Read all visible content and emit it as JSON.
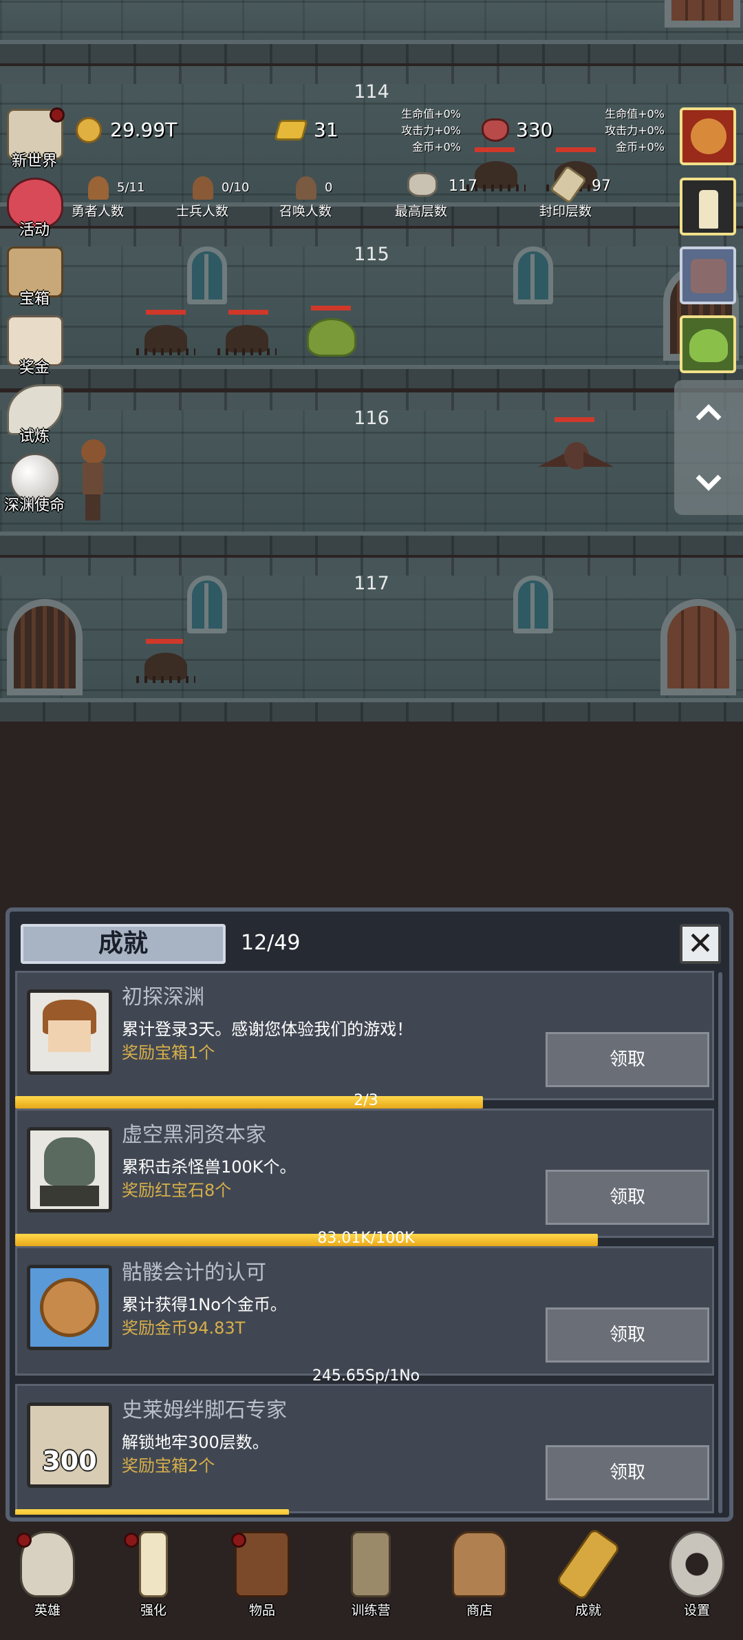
{
  "floors": [
    {
      "number": "114"
    },
    {
      "number": "115"
    },
    {
      "number": "116"
    },
    {
      "number": "117"
    }
  ],
  "stats": {
    "gold": "29.99T",
    "gold_bar": "31",
    "ruby": "330",
    "bonus_left": [
      "生命值+0%",
      "攻击力+0%",
      "金币+0%"
    ],
    "bonus_right": [
      "生命值+0%",
      "攻击力+0%",
      "金币+0%"
    ],
    "brave_count": "5/11",
    "brave_label": "勇者人数",
    "soldier_count": "0/10",
    "soldier_label": "士兵人数",
    "summon_count": "0",
    "summon_label": "召唤人数",
    "max_floor_value": "117",
    "max_floor_label": "最高层数",
    "sealed_floor_value": "97",
    "sealed_floor_label": "封印层数"
  },
  "side_menu": [
    {
      "label": "新世界",
      "icon": "map-icon",
      "dot": true
    },
    {
      "label": "活动",
      "icon": "heart-icon",
      "dot": false
    },
    {
      "label": "宝箱",
      "icon": "chest-icon",
      "dot": false
    },
    {
      "label": "奖金",
      "icon": "envelope-icon",
      "dot": false
    },
    {
      "label": "试炼",
      "icon": "wing-icon",
      "dot": false
    },
    {
      "label": "深渊使命",
      "icon": "orb-icon",
      "dot": false
    }
  ],
  "right_cards": [
    "bomb-icon",
    "candle-icon",
    "chest-monster-icon",
    "slime-icon"
  ],
  "panel": {
    "tab_title": "成就",
    "count": "12/49",
    "close": "✕"
  },
  "achievements": [
    {
      "name": "初探深渊",
      "desc": "累计登录3天。感谢您体验我们的游戏！",
      "reward": "奖励宝箱1个",
      "claim": "领取",
      "progress_text": "2/3",
      "progress": 0.667,
      "icon": "hero-portrait-icon"
    },
    {
      "name": "虚空黑洞资本家",
      "desc": "累积击杀怪兽100K个。",
      "reward": "奖励红宝石8个",
      "claim": "领取",
      "progress_text": "83.01K/100K",
      "progress": 0.83,
      "icon": "zombie-portrait-icon"
    },
    {
      "name": "骷髅会计的认可",
      "desc": "累计获得1No个金币。",
      "reward": "奖励金币94.83T",
      "claim": "领取",
      "progress_text": "245.65Sp/1No",
      "progress": 0.0,
      "icon": "coin-portrait-icon"
    },
    {
      "name": "史莱姆绊脚石专家",
      "desc": "解锁地牢300层数。",
      "reward": "奖励宝箱2个",
      "claim": "领取",
      "progress_text": "",
      "progress": 0.39,
      "icon": "map-300-icon",
      "thumb_text": "300"
    }
  ],
  "nav": [
    {
      "label": "英雄",
      "icon": "skull-icon",
      "dot": true
    },
    {
      "label": "强化",
      "icon": "candle-icon",
      "dot": true
    },
    {
      "label": "物品",
      "icon": "book-icon",
      "dot": true
    },
    {
      "label": "训练营",
      "icon": "lantern-icon",
      "dot": false
    },
    {
      "label": "商店",
      "icon": "beer-mug-icon",
      "dot": false
    },
    {
      "label": "成就",
      "icon": "key-icon",
      "dot": false
    },
    {
      "label": "设置",
      "icon": "gear-icon",
      "dot": false
    }
  ],
  "colors": {
    "progress_fill": "#f5c02c",
    "reward_text": "#d8b04a",
    "panel_bg": "#262a33",
    "hp_bar": "#d0382a"
  }
}
